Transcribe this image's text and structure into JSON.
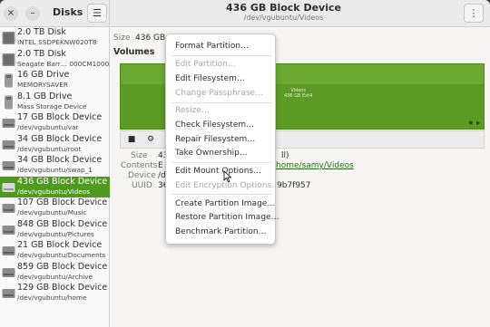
{
  "app": {
    "title": "Disks",
    "close_symbol": "×",
    "minimize_symbol": "–",
    "menu_symbol": "☰"
  },
  "header": {
    "title": "436 GB Block Device",
    "subtitle": "/dev/vgubuntu/Videos",
    "kebab_symbol": "⋮"
  },
  "sidebar": {
    "items": [
      {
        "name": "2.0 TB Disk",
        "sub": "INTEL SSDPEKNW020T8",
        "icon": "ssd-icon"
      },
      {
        "name": "2.0 TB Disk",
        "sub": "Seagate Barr… 000CM10002",
        "icon": "ssd-icon"
      },
      {
        "name": "16 GB Drive",
        "sub": "MEMORYSAVER",
        "icon": "usb-drive-icon"
      },
      {
        "name": "8.1 GB Drive",
        "sub": "Mass Storage Device",
        "icon": "usb-drive-icon"
      },
      {
        "name": "17 GB Block Device",
        "sub": "/dev/vgubuntu/var",
        "icon": "block-device-icon"
      },
      {
        "name": "34 GB Block Device",
        "sub": "/dev/vgubuntu/root",
        "icon": "block-device-icon"
      },
      {
        "name": "34 GB Block Device",
        "sub": "/dev/vgubuntu/swap_1",
        "icon": "block-device-icon"
      },
      {
        "name": "436 GB Block Device",
        "sub": "/dev/vgubuntu/Videos",
        "icon": "block-device-icon"
      },
      {
        "name": "107 GB Block Device",
        "sub": "/dev/vgubuntu/Music",
        "icon": "block-device-icon"
      },
      {
        "name": "848 GB Block Device",
        "sub": "/dev/vgubuntu/Pictures",
        "icon": "block-device-icon"
      },
      {
        "name": "21 GB Block Device",
        "sub": "/dev/vgubuntu/Documents",
        "icon": "block-device-icon"
      },
      {
        "name": "859 GB Block Device",
        "sub": "/dev/vgubuntu/Archive",
        "icon": "block-device-icon"
      },
      {
        "name": "129 GB Block Device",
        "sub": "/dev/vgubuntu/home",
        "icon": "block-device-icon"
      }
    ],
    "selected_index": 7
  },
  "main": {
    "size_label": "Size",
    "size_value": "436 GB",
    "volumes_label": "Volumes",
    "volume_map_text1": "Videos",
    "volume_map_text2": "436 GB Ext4",
    "details": {
      "size_label": "Size",
      "size_value_partial": "43",
      "size_value_tail": "ll)",
      "contents_label": "Contents",
      "contents_value_partial": "E",
      "contents_link": "/home/samy/Videos",
      "device_label": "Device",
      "device_value_partial": "/d",
      "uuid_label": "UUID",
      "uuid_value_partial": "36",
      "uuid_value_tail": "9b7f957"
    },
    "toolbar": {
      "stop_symbol": "■",
      "gear_symbol": "⚙"
    },
    "star_symbol": "★ ▸"
  },
  "menu": {
    "items": [
      {
        "label": "Format Partition…",
        "enabled": true
      },
      {
        "label": "Edit Partition…",
        "enabled": false
      },
      {
        "label": "Edit Filesystem…",
        "enabled": true
      },
      {
        "label": "Change Passphrase…",
        "enabled": false
      },
      {
        "label": "Resize…",
        "enabled": false
      },
      {
        "label": "Check Filesystem…",
        "enabled": true
      },
      {
        "label": "Repair Filesystem…",
        "enabled": true
      },
      {
        "label": "Take Ownership…",
        "enabled": true
      },
      {
        "label": "Edit Mount Options…",
        "enabled": true
      },
      {
        "label": "Edit Encryption Options…",
        "enabled": false
      },
      {
        "label": "Create Partition Image…",
        "enabled": true
      },
      {
        "label": "Restore Partition Image…",
        "enabled": true
      },
      {
        "label": "Benchmark Partition…",
        "enabled": true
      }
    ]
  },
  "colors": {
    "accent": "#4d9a1c",
    "volume_fill": "#5c9b23"
  }
}
